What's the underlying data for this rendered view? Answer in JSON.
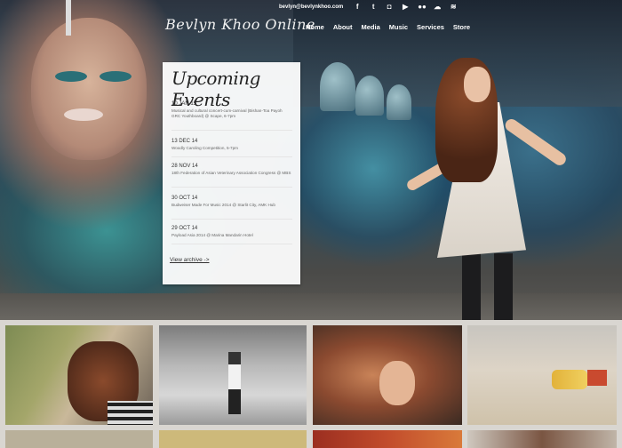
{
  "site": {
    "title": "Bevlyn Khoo Online",
    "email": "bevlyn@bevlynkhoo.com"
  },
  "social": [
    {
      "icon": "facebook-icon",
      "glyph": "f"
    },
    {
      "icon": "twitter-icon",
      "glyph": "t"
    },
    {
      "icon": "instagram-icon",
      "glyph": "◘"
    },
    {
      "icon": "youtube-icon",
      "glyph": "▶"
    },
    {
      "icon": "flickr-icon",
      "glyph": "●●"
    },
    {
      "icon": "soundcloud-icon",
      "glyph": "☁"
    },
    {
      "icon": "rss-icon",
      "glyph": "≋"
    }
  ],
  "nav": [
    "Home",
    "About",
    "Media",
    "Music",
    "Services",
    "Store"
  ],
  "events": {
    "title": "Upcoming Events",
    "items": [
      {
        "date": "10 JAN 15",
        "text": "Musical and cultural concert-cum-carnival (Bishan-Toa Payoh GRC Youthboard) @ Scape, 6-7pm"
      },
      {
        "date": "13 DEC 14",
        "text": "Woodly Caroling Competition, 5-7pm"
      },
      {
        "date": "28 NOV 14",
        "text": "18th Federation of Asian Veterinary Association Congress @ MBS"
      },
      {
        "date": "30 OCT 14",
        "text": "Budweiser Made For Music 2014 @ Starlit City, AMK Hub"
      },
      {
        "date": "29 OCT 14",
        "text": "Payload Asia 2014 @ Marina Mandarin Hotel"
      }
    ],
    "archive_label": "View archive ->"
  },
  "colors": {
    "accent": "#ffffff",
    "card_bg": "#ffffff",
    "gallery_bg": "#d9d6d1"
  }
}
